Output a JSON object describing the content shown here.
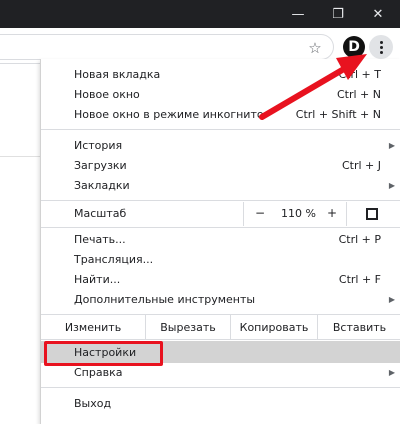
{
  "window": {
    "minimize_glyph": "—",
    "maximize_glyph": "❐",
    "close_glyph": "✕"
  },
  "toolbar": {
    "bookmark_glyph": "☆",
    "extension_letter": "D",
    "menu_icon": "kebab-vertical-dots-icon"
  },
  "menu": {
    "group1": [
      {
        "label": "Новая вкладка",
        "shortcut": "Ctrl + T"
      },
      {
        "label": "Новое окно",
        "shortcut": "Ctrl + N"
      },
      {
        "label": "Новое окно в режиме инкогнито",
        "shortcut": "Ctrl + Shift + N"
      }
    ],
    "group2": [
      {
        "label": "История",
        "shortcut": ""
      },
      {
        "label": "Загрузки",
        "shortcut": "Ctrl + J"
      },
      {
        "label": "Закладки",
        "shortcut": ""
      }
    ],
    "zoom": {
      "label": "Масштаб",
      "minus": "−",
      "value": "110 %",
      "plus": "+"
    },
    "group3": [
      {
        "label": "Печать...",
        "shortcut": "Ctrl + P"
      },
      {
        "label": "Трансляция...",
        "shortcut": ""
      },
      {
        "label": "Найти...",
        "shortcut": "Ctrl + F"
      },
      {
        "label": "Дополнительные инструменты",
        "shortcut": ""
      }
    ],
    "edit": {
      "label": "Изменить",
      "cut": "Вырезать",
      "copy": "Копировать",
      "paste": "Вставить"
    },
    "group4": [
      {
        "label": "Настройки"
      },
      {
        "label": "Справка"
      }
    ],
    "exit": {
      "label": "Выход"
    },
    "submenu_arrow": "▶"
  },
  "colors": {
    "annotation_red": "#e8121f",
    "titlebar": "#202124",
    "highlight": "#d3d3d3"
  }
}
